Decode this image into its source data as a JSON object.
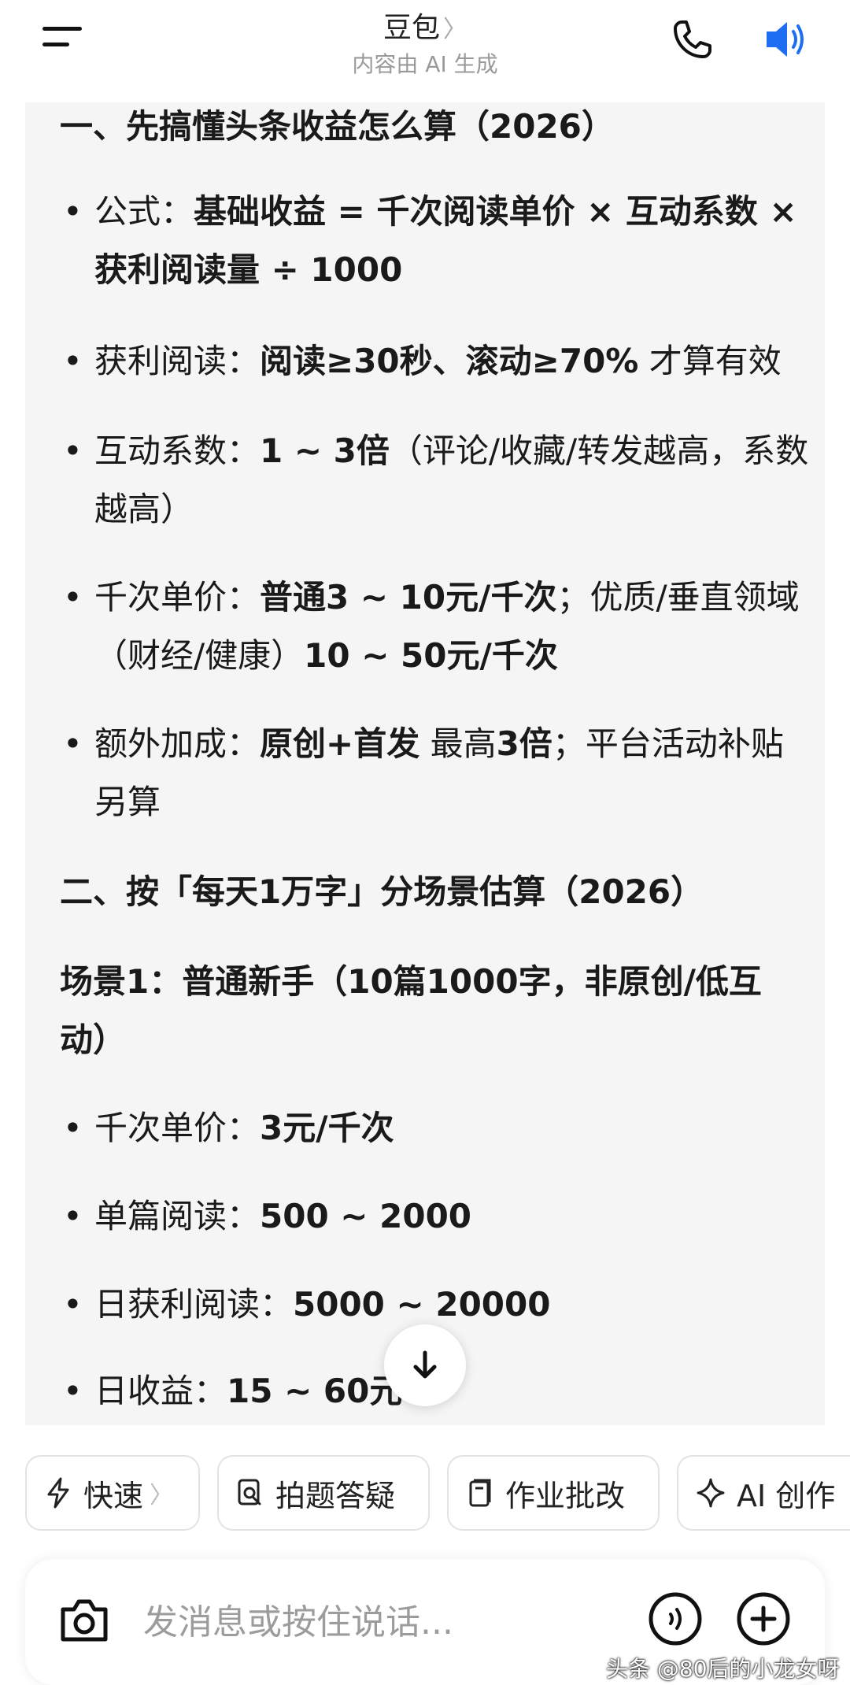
{
  "header": {
    "title": "豆包",
    "title_chevron": "〉",
    "subtitle": "内容由 AI 生成",
    "accent_color": "#1e6ef4"
  },
  "icons": {
    "menu": "menu-icon",
    "phone": "phone-icon",
    "speaker": "speaker-icon",
    "scroll_down": "arrow-down-icon",
    "camera": "camera-icon",
    "voice": "voice-icon",
    "plus": "plus-icon"
  },
  "content": {
    "section1_title": "一、先搞懂头条收益怎么算（2026）",
    "formula_label": "公式：",
    "formula_value": "基础收益 = 千次阅读单价 × 互动系数 × 获利阅读量 ÷ 1000",
    "profit_read_label": "获利阅读：",
    "profit_read_value": "阅读≥30秒、滚动≥70%",
    "profit_read_tail": " 才算有效",
    "interact_label": "互动系数：",
    "interact_value": "1 ~ 3倍",
    "interact_tail": "（评论/收藏/转发越高，系数越高）",
    "price_label": "千次单价：",
    "price_value1": "普通3 ~ 10元/千次",
    "price_mid": "；优质/垂直领域（财经/健康）",
    "price_value2": "10 ~ 50元/千次",
    "bonus_label": "额外加成：",
    "bonus_value1": "原创+首发",
    "bonus_mid": " 最高",
    "bonus_value2": "3倍",
    "bonus_tail": "；平台活动补贴另算",
    "section2_title": "二、按「每天1万字」分场景估算（2026）",
    "scene1_title": "场景1：普通新手（10篇1000字，非原创/低互动）",
    "s1_price_label": "千次单价：",
    "s1_price_value": "3元/千次",
    "s1_read_label": "单篇阅读：",
    "s1_read_value": "500 ~ 2000",
    "s1_daily_read_label": "日获利阅读：",
    "s1_daily_read_value": "5000 ~ 20000",
    "s1_income_label": "日收益：",
    "s1_income_value": "15 ~ 60元"
  },
  "chips": [
    {
      "label": "快速",
      "icon": "lightning-icon",
      "chevron": "〉"
    },
    {
      "label": "拍题答疑",
      "icon": "photo-search-icon"
    },
    {
      "label": "作业批改",
      "icon": "homework-icon"
    },
    {
      "label": "AI 创作",
      "icon": "sparkle-icon"
    }
  ],
  "input": {
    "placeholder": "发消息或按住说话..."
  },
  "watermark": "头条 @80后的小龙女呀"
}
